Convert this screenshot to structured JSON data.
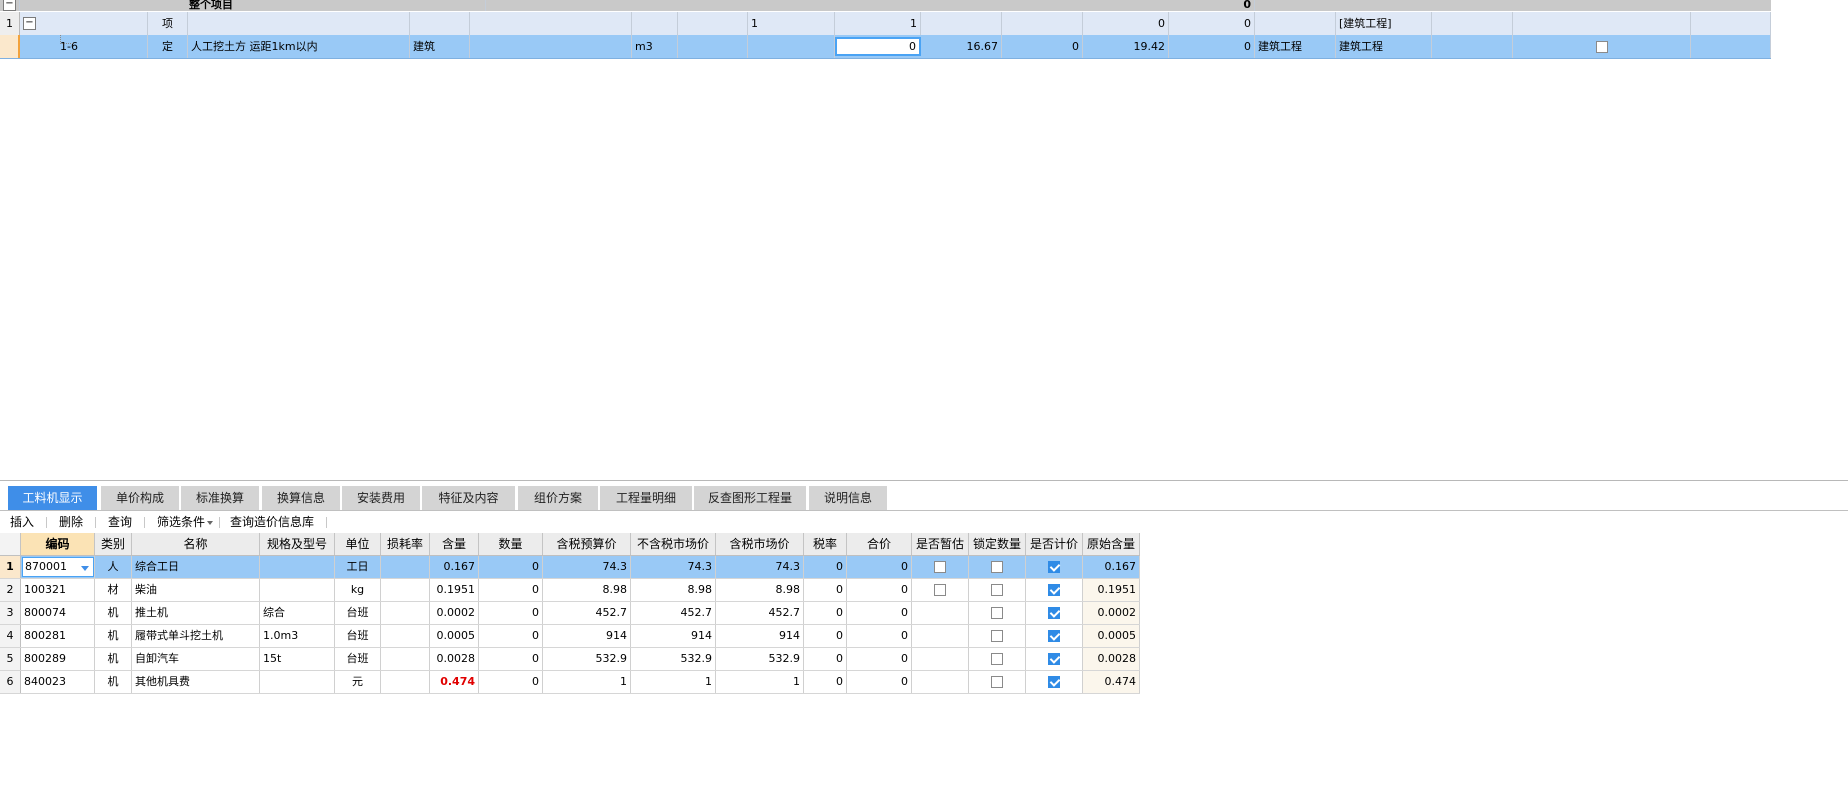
{
  "upper_grid": {
    "header_text": "整个项目",
    "header_value": "0",
    "rows": [
      {
        "num": "1",
        "code": "",
        "type": "项",
        "name": "",
        "spec": "",
        "unit": "",
        "expr": "1",
        "qty": "1",
        "c1": "",
        "c2": "",
        "c3": "0",
        "c4": "0",
        "prof": "",
        "prof2": "[建筑工程]"
      },
      {
        "num": "",
        "code": "1-6",
        "type": "定",
        "name": "人工挖土方 运距1km以内",
        "spec": "建筑",
        "unit": "m3",
        "expr": "",
        "qty": "0",
        "c1": "16.67",
        "c2": "0",
        "c3": "19.42",
        "c4": "0",
        "prof": "建筑工程",
        "prof2": "建筑工程"
      }
    ]
  },
  "tabs": [
    "工料机显示",
    "单价构成",
    "标准换算",
    "换算信息",
    "安装费用",
    "特征及内容",
    "组价方案",
    "工程量明细",
    "反查图形工程量",
    "说明信息"
  ],
  "toolbar": {
    "insert": "插入",
    "delete": "删除",
    "query": "查询",
    "filter": "筛选条件",
    "query_db": "查询造价信息库"
  },
  "columns": [
    "编码",
    "类别",
    "名称",
    "规格及型号",
    "单位",
    "损耗率",
    "含量",
    "数量",
    "含税预算价",
    "不含税市场价",
    "含税市场价",
    "税率",
    "合价",
    "是否暂估",
    "锁定数量",
    "是否计价",
    "原始含量"
  ],
  "rows": [
    {
      "num": "1",
      "code": "870001",
      "cat": "人",
      "name": "综合工日",
      "spec": "",
      "unit": "工日",
      "loss": "",
      "content": "0.167",
      "qty": "0",
      "tax_budget": "74.3",
      "market_ex": "74.3",
      "market_in": "74.3",
      "rate": "0",
      "total": "0",
      "estimate": false,
      "locked": false,
      "priced": true,
      "orig": "0.167"
    },
    {
      "num": "2",
      "code": "100321",
      "cat": "材",
      "name": "柴油",
      "spec": "",
      "unit": "kg",
      "loss": "",
      "content": "0.1951",
      "qty": "0",
      "tax_budget": "8.98",
      "market_ex": "8.98",
      "market_in": "8.98",
      "rate": "0",
      "total": "0",
      "estimate": false,
      "locked": false,
      "priced": true,
      "orig": "0.1951"
    },
    {
      "num": "3",
      "code": "800074",
      "cat": "机",
      "name": "推土机",
      "spec": "综合",
      "unit": "台班",
      "loss": "",
      "content": "0.0002",
      "qty": "0",
      "tax_budget": "452.7",
      "market_ex": "452.7",
      "market_in": "452.7",
      "rate": "0",
      "total": "0",
      "estimate": null,
      "locked": false,
      "priced": true,
      "orig": "0.0002"
    },
    {
      "num": "4",
      "code": "800281",
      "cat": "机",
      "name": "履带式单斗挖土机",
      "spec": "1.0m3",
      "unit": "台班",
      "loss": "",
      "content": "0.0005",
      "qty": "0",
      "tax_budget": "914",
      "market_ex": "914",
      "market_in": "914",
      "rate": "0",
      "total": "0",
      "estimate": null,
      "locked": false,
      "priced": true,
      "orig": "0.0005"
    },
    {
      "num": "5",
      "code": "800289",
      "cat": "机",
      "name": "自卸汽车",
      "spec": "15t",
      "unit": "台班",
      "loss": "",
      "content": "0.0028",
      "qty": "0",
      "tax_budget": "532.9",
      "market_ex": "532.9",
      "market_in": "532.9",
      "rate": "0",
      "total": "0",
      "estimate": null,
      "locked": false,
      "priced": true,
      "orig": "0.0028"
    },
    {
      "num": "6",
      "code": "840023",
      "cat": "机",
      "name": "其他机具费",
      "spec": "",
      "unit": "元",
      "loss": "",
      "content": "0.474",
      "qty": "0",
      "tax_budget": "1",
      "market_ex": "1",
      "market_in": "1",
      "rate": "0",
      "total": "0",
      "estimate": null,
      "locked": false,
      "priced": true,
      "orig": "0.474"
    }
  ]
}
